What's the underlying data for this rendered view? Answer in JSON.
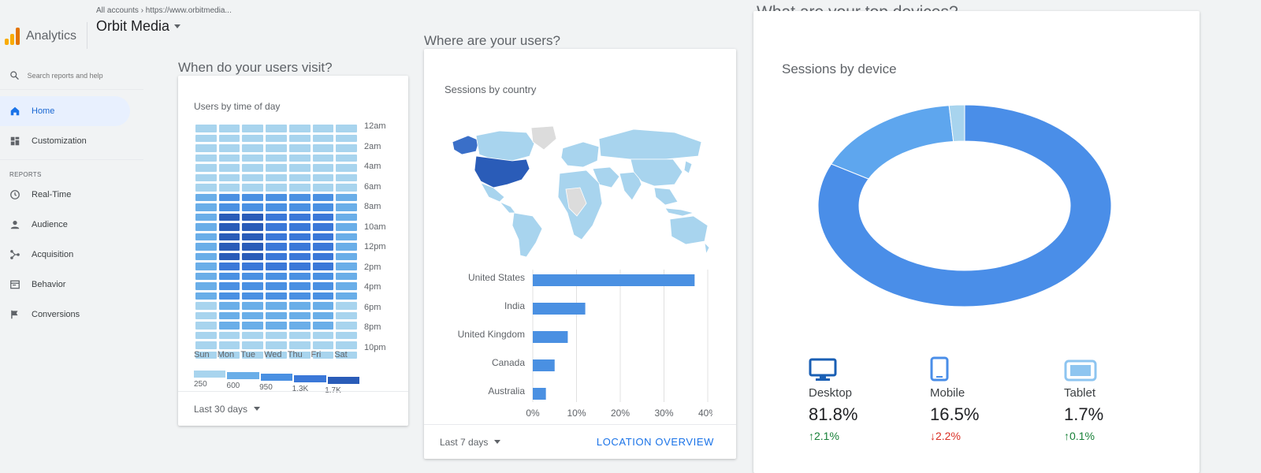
{
  "header": {
    "app_name": "Analytics",
    "breadcrumb": "All accounts › https://www.orbitmedia...",
    "property": "Orbit Media"
  },
  "sidebar": {
    "search_placeholder": "Search reports and help",
    "section_label": "REPORTS",
    "items": [
      {
        "label": "Home",
        "icon": "home-icon"
      },
      {
        "label": "Customization",
        "icon": "customization-icon"
      },
      {
        "label": "Real-Time",
        "icon": "clock-icon"
      },
      {
        "label": "Audience",
        "icon": "person-icon"
      },
      {
        "label": "Acquisition",
        "icon": "acquisition-icon"
      },
      {
        "label": "Behavior",
        "icon": "behavior-icon"
      },
      {
        "label": "Conversions",
        "icon": "flag-icon"
      }
    ]
  },
  "sections": {
    "visit": "When do your users visit?",
    "where": "Where are your users?",
    "devices": "What are your top devices?"
  },
  "visit_card": {
    "title": "Users by time of day",
    "hours": [
      "12am",
      "2am",
      "4am",
      "6am",
      "8am",
      "10am",
      "12pm",
      "2pm",
      "4pm",
      "6pm",
      "8pm",
      "10pm"
    ],
    "days": [
      "Sun",
      "Mon",
      "Tue",
      "Wed",
      "Thu",
      "Fri",
      "Sat"
    ],
    "legend": [
      "250",
      "600",
      "950",
      "1.3K",
      "1.7K"
    ],
    "legend_colors": [
      "#a8d4ee",
      "#6aaee8",
      "#4a90e2",
      "#3b78d8",
      "#2a5cb8"
    ],
    "footer": "Last 30 days"
  },
  "country_card": {
    "title": "Sessions by country",
    "footer": "Last 7 days",
    "link": "LOCATION OVERVIEW"
  },
  "device_card": {
    "title": "Sessions by device",
    "devices": [
      {
        "name": "Desktop",
        "pct": "81.8%",
        "change": "2.1%",
        "direction": "up",
        "icon": "desktop-icon"
      },
      {
        "name": "Mobile",
        "pct": "16.5%",
        "change": "2.2%",
        "direction": "down",
        "icon": "mobile-icon"
      },
      {
        "name": "Tablet",
        "pct": "1.7%",
        "change": "0.1%",
        "direction": "up",
        "icon": "tablet-icon"
      }
    ]
  },
  "chart_data": [
    {
      "type": "bar",
      "orientation": "horizontal",
      "categories": [
        "United States",
        "India",
        "United Kingdom",
        "Canada",
        "Australia"
      ],
      "values": [
        37,
        12,
        8,
        5,
        3
      ],
      "xlim": [
        0,
        40
      ],
      "xticks": [
        "0%",
        "10%",
        "20%",
        "30%",
        "40%"
      ],
      "color": "#4a90e2"
    },
    {
      "type": "pie",
      "style": "donut",
      "categories": [
        "Desktop",
        "Mobile",
        "Tablet"
      ],
      "values": [
        81.8,
        16.5,
        1.7
      ],
      "colors": [
        "#4a8ee8",
        "#5ea6ee",
        "#a8d4ee"
      ]
    }
  ]
}
